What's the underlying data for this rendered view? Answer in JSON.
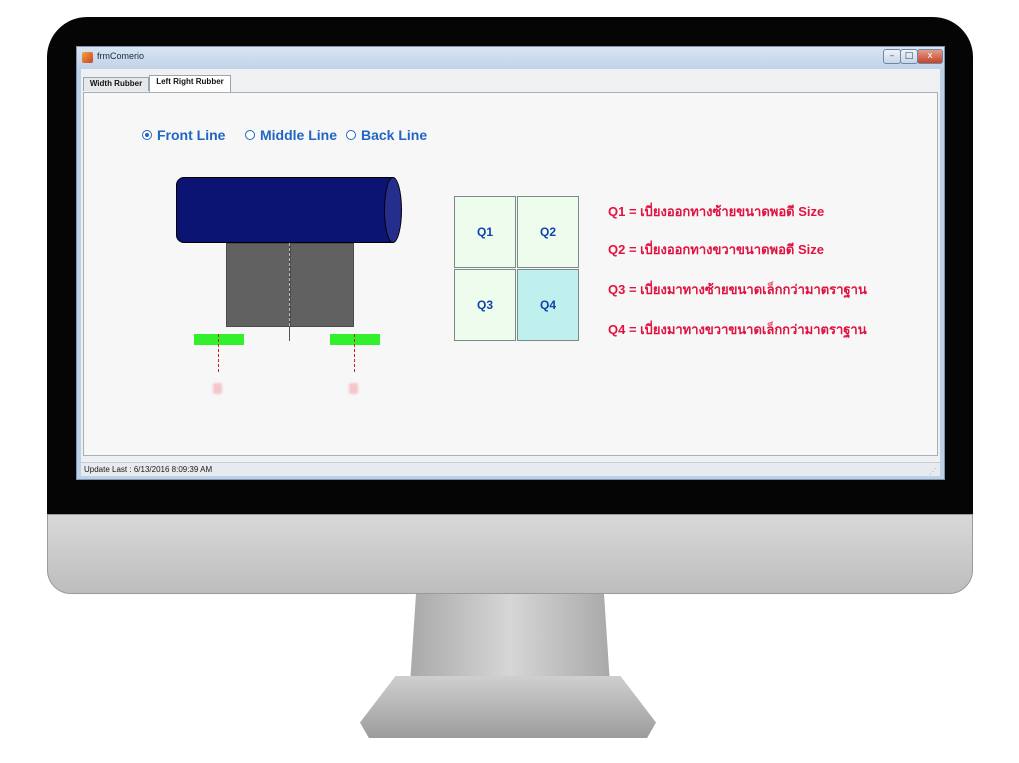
{
  "window": {
    "title": "frmComerio",
    "controls": {
      "minimize": "–",
      "maximize": "□",
      "close": "x"
    }
  },
  "tabs": [
    {
      "label": "Width Rubber",
      "active": false
    },
    {
      "label": "Left Right Rubber",
      "active": true
    }
  ],
  "line_options": [
    {
      "label": "Front Line",
      "selected": true
    },
    {
      "label": "Middle Line",
      "selected": false
    },
    {
      "label": "Back Line",
      "selected": false
    }
  ],
  "quadrants": [
    {
      "label": "Q1",
      "color": "#eefcee"
    },
    {
      "label": "Q2",
      "color": "#eefcee"
    },
    {
      "label": "Q3",
      "color": "#eefcee"
    },
    {
      "label": "Q4",
      "color": "#bff0ee"
    }
  ],
  "legend": [
    "Q1 = เบี่ยงออกทางซ้ายขนาดพอดี Size",
    "Q2 = เบี่ยงออกทางขวาขนาดพอดี Size",
    "Q3 = เบี่ยงมาทางซ้ายขนาดเล็กกว่ามาตราฐาน",
    "Q4 = เบี่ยงมาทางขวาขนาดเล็กกว่ามาตราฐาน"
  ],
  "status": {
    "update_label": "Update Last :",
    "update_time": "6/13/2016 8:09:39 AM"
  },
  "colors": {
    "radio_text": "#2266c4",
    "legend_text": "#e0123f",
    "roller": "#0c1473",
    "rubber_strip": "#33f02d",
    "highlight_quadrant": "#bff0ee"
  }
}
